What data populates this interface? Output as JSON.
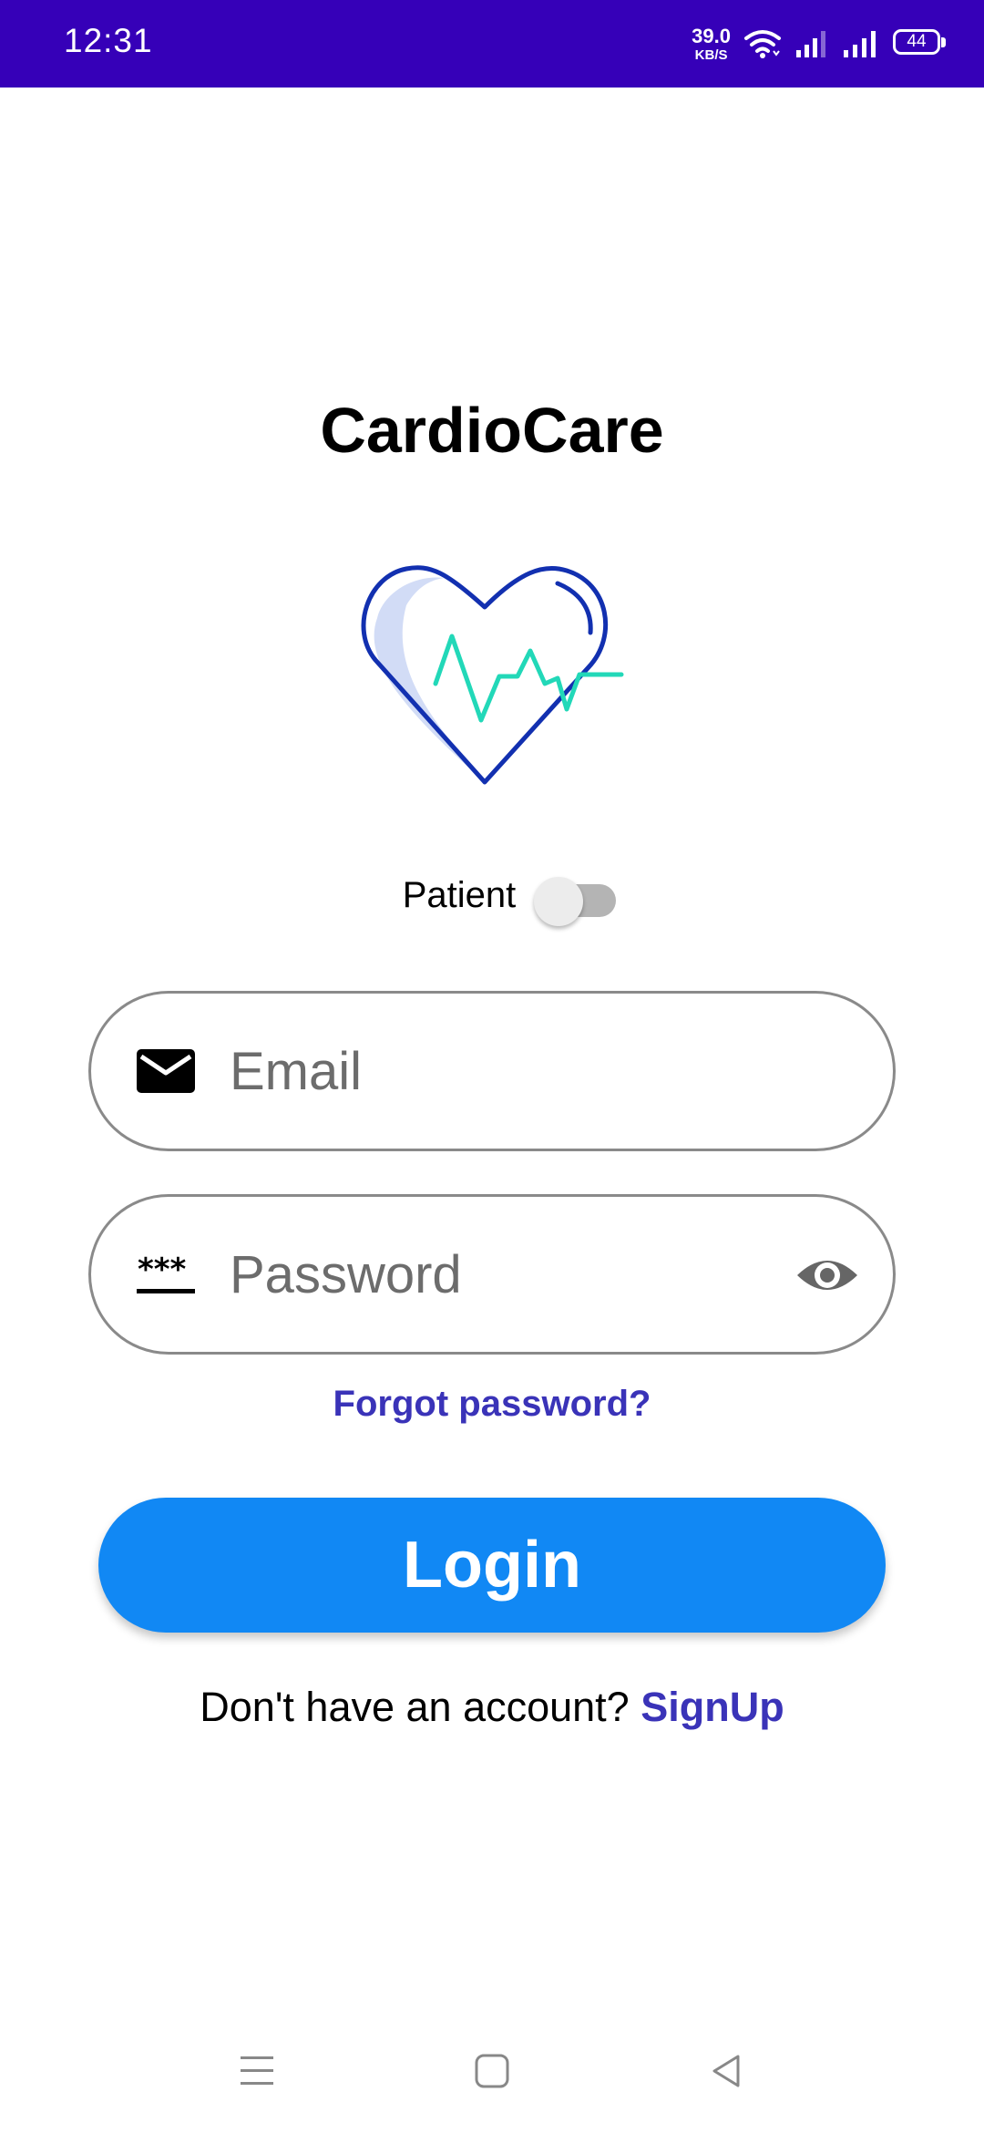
{
  "status_bar": {
    "time": "12:31",
    "net_speed_value": "39.0",
    "net_speed_unit": "KB/S",
    "battery": "44",
    "icons": [
      "wifi-icon",
      "signal-icon",
      "signal-icon",
      "battery-icon"
    ],
    "background_color": "#3600b8"
  },
  "app": {
    "title": "CardioCare",
    "logo_icon": "heart-pulse-icon"
  },
  "role_toggle": {
    "label": "Patient",
    "checked": false
  },
  "form": {
    "email_placeholder": "Email",
    "email_icon": "envelope-icon",
    "password_placeholder": "Password",
    "password_icon": "password-dots-icon",
    "visibility_icon": "eye-icon",
    "forgot_label": "Forgot password?",
    "login_label": "Login"
  },
  "signup": {
    "prompt": "Don't have an account? ",
    "link_label": "SignUp"
  },
  "colors": {
    "accent": "#1188f4",
    "link": "#3a33b8",
    "heart_outline": "#1230b0",
    "pulse_line": "#22d8b8"
  },
  "nav_bar": {
    "icons": [
      "menu-icon",
      "home-icon",
      "back-icon"
    ]
  }
}
